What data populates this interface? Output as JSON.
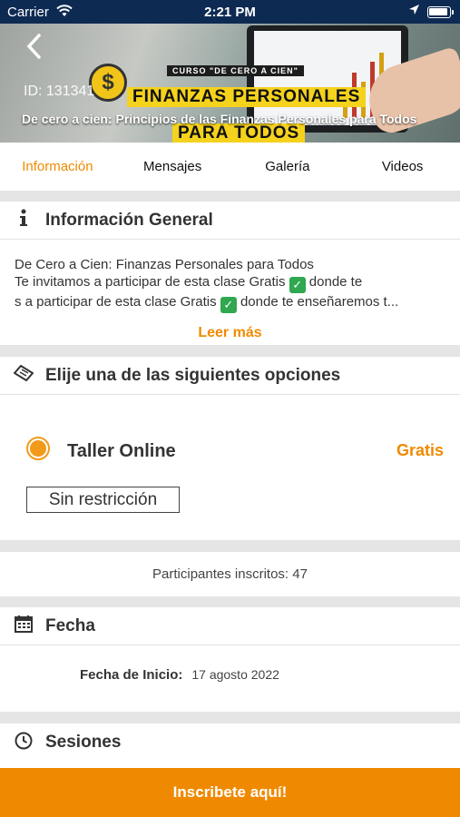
{
  "status_bar": {
    "carrier": "Carrier",
    "time": "2:21 PM"
  },
  "hero": {
    "course_tag": "CURSO \"DE CERO A CIEN\"",
    "id_text": "ID: 131341",
    "title_line1": "FINANZAS PERSONALES",
    "title_line2": "PARA TODOS",
    "caption": "De cero a cien: Principios de las Finanzas Personales para Todos",
    "coin_symbol": "$"
  },
  "tabs": [
    {
      "label": "Información",
      "active": true
    },
    {
      "label": "Mensajes"
    },
    {
      "label": "Galería"
    },
    {
      "label": "Videos"
    }
  ],
  "info_section": {
    "title": "Información General",
    "icon": "info-icon",
    "line1": "De Cero a Cien: Finanzas Personales para Todos",
    "line2_text": "Te invitamos a participar de esta clase Gratis",
    "line2_tail": " donde te",
    "line3_text": "s a participar de esta clase Gratis",
    "line3_tail": " donde te enseñaremos t...",
    "read_more": "Leer más"
  },
  "options_section": {
    "title": "Elije una de las siguientes opciones",
    "icon": "ticket-icon",
    "option": {
      "name": "Taller Online",
      "price": "Gratis",
      "selected": true
    },
    "restriction": "Sin restricción"
  },
  "participants": "Participantes inscritos: 47",
  "date_section": {
    "title": "Fecha",
    "icon": "calendar-icon",
    "start_label": "Fecha de Inicio:",
    "start_value": "17 agosto 2022"
  },
  "sessions_section": {
    "title": "Sesiones",
    "icon": "clock-icon"
  },
  "cta": {
    "label": "Inscribete aquí!"
  },
  "colors": {
    "accent": "#ef8a00",
    "status_bar": "#0d2a52",
    "radio": "#f29a1a"
  }
}
